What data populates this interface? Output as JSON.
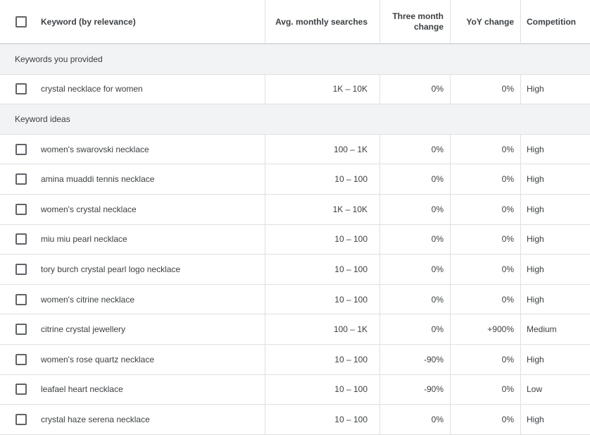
{
  "header": {
    "keyword": "Keyword (by relevance)",
    "avg": "Avg. monthly searches",
    "three_line1": "Three month",
    "three_line2": "change",
    "yoy": "YoY change",
    "competition": "Competition"
  },
  "groups": {
    "provided": "Keywords you provided",
    "ideas": "Keyword ideas"
  },
  "provided_rows": [
    {
      "keyword": "crystal necklace for women",
      "avg": "1K – 10K",
      "three": "0%",
      "yoy": "0%",
      "competition": "High"
    }
  ],
  "idea_rows": [
    {
      "keyword": "women's swarovski necklace",
      "avg": "100 – 1K",
      "three": "0%",
      "yoy": "0%",
      "competition": "High"
    },
    {
      "keyword": "amina muaddi tennis necklace",
      "avg": "10 – 100",
      "three": "0%",
      "yoy": "0%",
      "competition": "High"
    },
    {
      "keyword": "women's crystal necklace",
      "avg": "1K – 10K",
      "three": "0%",
      "yoy": "0%",
      "competition": "High"
    },
    {
      "keyword": "miu miu pearl necklace",
      "avg": "10 – 100",
      "three": "0%",
      "yoy": "0%",
      "competition": "High"
    },
    {
      "keyword": "tory burch crystal pearl logo necklace",
      "avg": "10 – 100",
      "three": "0%",
      "yoy": "0%",
      "competition": "High"
    },
    {
      "keyword": "women's citrine necklace",
      "avg": "10 – 100",
      "three": "0%",
      "yoy": "0%",
      "competition": "High"
    },
    {
      "keyword": "citrine crystal jewellery",
      "avg": "100 – 1K",
      "three": "0%",
      "yoy": "+900%",
      "competition": "Medium"
    },
    {
      "keyword": "women's rose quartz necklace",
      "avg": "10 – 100",
      "three": "-90%",
      "yoy": "0%",
      "competition": "High"
    },
    {
      "keyword": "leafael heart necklace",
      "avg": "10 – 100",
      "three": "-90%",
      "yoy": "0%",
      "competition": "Low"
    },
    {
      "keyword": "crystal haze serena necklace",
      "avg": "10 – 100",
      "three": "0%",
      "yoy": "0%",
      "competition": "High"
    }
  ]
}
